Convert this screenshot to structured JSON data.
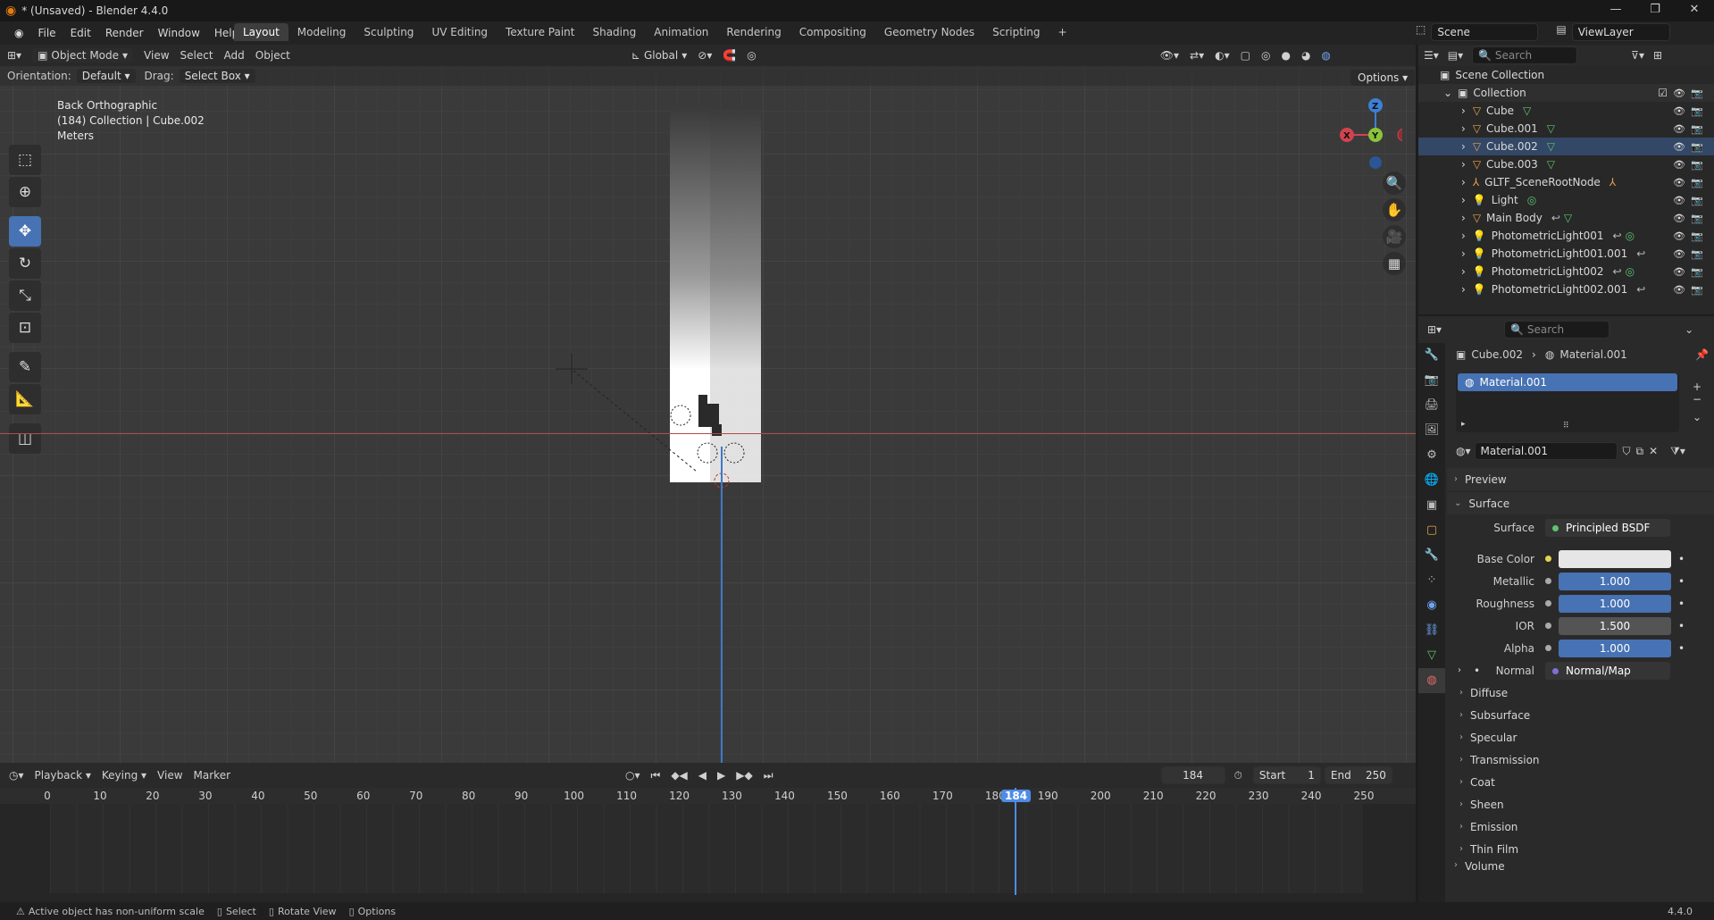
{
  "window": {
    "title": "* (Unsaved) - Blender 4.4.0"
  },
  "menus": [
    "File",
    "Edit",
    "Render",
    "Window",
    "Help"
  ],
  "workspaces": [
    "Layout",
    "Modeling",
    "Sculpting",
    "UV Editing",
    "Texture Paint",
    "Shading",
    "Animation",
    "Rendering",
    "Compositing",
    "Geometry Nodes",
    "Scripting"
  ],
  "active_workspace": "Layout",
  "scene": {
    "name": "Scene",
    "viewlayer": "ViewLayer"
  },
  "viewport": {
    "mode": "Object Mode",
    "menus": [
      "View",
      "Select",
      "Add",
      "Object"
    ],
    "transform_orientation": "Global",
    "orientation_label": "Orientation:",
    "orientation_value": "Default",
    "drag_label": "Drag:",
    "drag_value": "Select Box",
    "options": "Options",
    "overlay_line1": "Back Orthographic",
    "overlay_line2": "(184) Collection | Cube.002",
    "overlay_line3": "Meters",
    "gizmo_labels": {
      "z": "Z",
      "y": "Y",
      "x": "X"
    }
  },
  "outliner": {
    "search_placeholder": "Search",
    "scene_collection": "Scene Collection",
    "collection": "Collection",
    "items": [
      {
        "name": "Cube",
        "type": "mesh"
      },
      {
        "name": "Cube.001",
        "type": "mesh"
      },
      {
        "name": "Cube.002",
        "type": "mesh"
      },
      {
        "name": "Cube.003",
        "type": "mesh"
      },
      {
        "name": "GLTF_SceneRootNode",
        "type": "empty"
      },
      {
        "name": "Light",
        "type": "light"
      },
      {
        "name": "Main Body",
        "type": "mesh"
      },
      {
        "name": "PhotometricLight001",
        "type": "light"
      },
      {
        "name": "PhotometricLight001.001",
        "type": "light"
      },
      {
        "name": "PhotometricLight002",
        "type": "light"
      },
      {
        "name": "PhotometricLight002.001",
        "type": "light"
      }
    ]
  },
  "properties": {
    "search_placeholder": "Search",
    "breadcrumb_object": "Cube.002",
    "breadcrumb_material": "Material.001",
    "slot": "Material.001",
    "material_name": "Material.001",
    "preview": "Preview",
    "surface_section": "Surface",
    "surface_label": "Surface",
    "surface_value": "Principled BSDF",
    "fields": [
      {
        "label": "Base Color",
        "value": "",
        "kind": "white"
      },
      {
        "label": "Metallic",
        "value": "1.000",
        "kind": "blue"
      },
      {
        "label": "Roughness",
        "value": "1.000",
        "kind": "blue"
      },
      {
        "label": "IOR",
        "value": "1.500",
        "kind": "grey"
      },
      {
        "label": "Alpha",
        "value": "1.000",
        "kind": "blue"
      }
    ],
    "normal_label": "Normal",
    "normal_value": "Normal/Map",
    "subsections": [
      "Diffuse",
      "Subsurface",
      "Specular",
      "Transmission",
      "Coat",
      "Sheen",
      "Emission",
      "Thin Film",
      "Volume"
    ]
  },
  "timeline": {
    "menus": [
      "Playback",
      "Keying",
      "View",
      "Marker"
    ],
    "current_frame": "184",
    "start_label": "Start",
    "start": "1",
    "end_label": "End",
    "end": "250",
    "ticks": [
      "0",
      "10",
      "20",
      "30",
      "40",
      "50",
      "60",
      "70",
      "80",
      "90",
      "100",
      "110",
      "120",
      "130",
      "140",
      "150",
      "160",
      "170",
      "180",
      "190",
      "200",
      "210",
      "220",
      "230",
      "240",
      "250"
    ],
    "playhead_label": "184"
  },
  "statusbar": {
    "warning": "Active object has non-uniform scale",
    "select": "Select",
    "rotate": "Rotate View",
    "options": "Options",
    "version": "4.4.0"
  },
  "colors": {
    "accent": "#4772b3",
    "x_axis": "#d2434f",
    "y_axis": "#8ac43a",
    "z_axis": "#3d7fd6"
  }
}
